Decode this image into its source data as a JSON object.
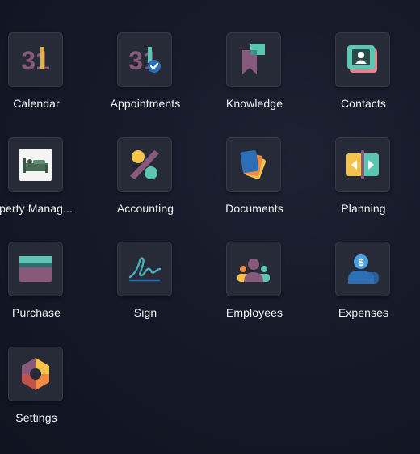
{
  "apps": [
    {
      "label": "Calendar",
      "icon": "calendar-icon"
    },
    {
      "label": "Appointments",
      "icon": "appointments-icon"
    },
    {
      "label": "Knowledge",
      "icon": "knowledge-icon"
    },
    {
      "label": "Contacts",
      "icon": "contacts-icon"
    },
    {
      "label": "operty Manag...",
      "icon": "property-management-icon"
    },
    {
      "label": "Accounting",
      "icon": "accounting-icon"
    },
    {
      "label": "Documents",
      "icon": "documents-icon"
    },
    {
      "label": "Planning",
      "icon": "planning-icon"
    },
    {
      "label": "Purchase",
      "icon": "purchase-icon"
    },
    {
      "label": "Sign",
      "icon": "sign-icon"
    },
    {
      "label": "Employees",
      "icon": "employees-icon"
    },
    {
      "label": "Expenses",
      "icon": "expenses-icon"
    },
    {
      "label": "Settings",
      "icon": "settings-icon"
    }
  ],
  "icon_text": {
    "calendar_number": "31",
    "appointments_number": "31",
    "expenses_symbol": "$"
  },
  "colors": {
    "tile_background": "#262b37",
    "label_text": "#f1f3f6",
    "teal": "#5cc6b4",
    "purple": "#875a7b",
    "orange": "#f08a44",
    "yellow": "#f6c34a",
    "blue": "#2d6fb6"
  }
}
